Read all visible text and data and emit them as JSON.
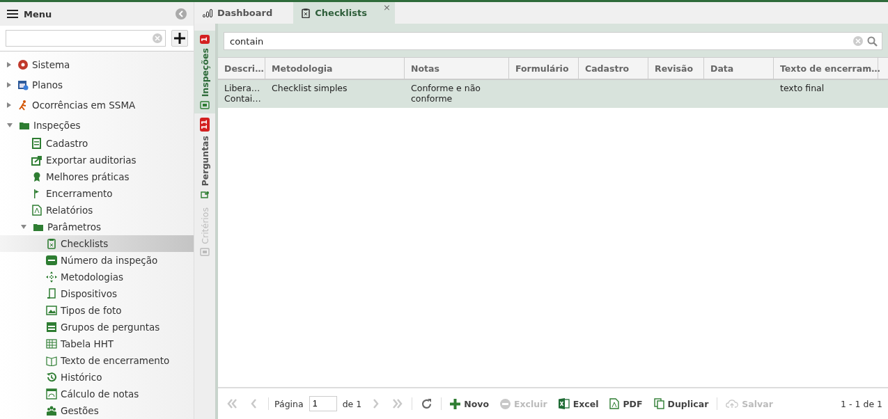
{
  "sidebar": {
    "title": "Menu",
    "tree": [
      {
        "label": "Sistema",
        "expanded": false,
        "selected": false
      },
      {
        "label": "Planos",
        "expanded": false,
        "selected": false
      },
      {
        "label": "Ocorrências em SSMA",
        "expanded": false,
        "selected": false
      },
      {
        "label": "Inspeções",
        "expanded": true,
        "selected": false,
        "children": [
          {
            "label": "Cadastro",
            "selected": false
          },
          {
            "label": "Exportar auditorias",
            "selected": false
          },
          {
            "label": "Melhores práticas",
            "selected": false
          },
          {
            "label": "Encerramento",
            "selected": false
          },
          {
            "label": "Relatórios",
            "selected": false
          },
          {
            "label": "Parâmetros",
            "expanded": true,
            "selected": false,
            "children": [
              {
                "label": "Checklists",
                "selected": true
              },
              {
                "label": "Número da inspeção",
                "selected": false
              },
              {
                "label": "Metodologias",
                "selected": false
              },
              {
                "label": "Dispositivos",
                "selected": false
              },
              {
                "label": "Tipos de foto",
                "selected": false
              },
              {
                "label": "Grupos de perguntas",
                "selected": false
              },
              {
                "label": "Tabela HHT",
                "selected": false
              },
              {
                "label": "Texto de encerramento",
                "selected": false
              },
              {
                "label": "Histórico",
                "selected": false
              },
              {
                "label": "Cálculo de notas",
                "selected": false
              },
              {
                "label": "Gestões",
                "selected": false
              }
            ]
          }
        ]
      }
    ]
  },
  "tabs": [
    {
      "label": "Dashboard",
      "selected": false
    },
    {
      "label": "Checklists",
      "selected": true,
      "close": "×"
    }
  ],
  "side_tabs": [
    {
      "label": "Inspeções",
      "badge": "1",
      "selected": true,
      "disabled": false
    },
    {
      "label": "Perguntas",
      "badge": "11",
      "selected": false,
      "disabled": false
    },
    {
      "label": "Critérios",
      "selected": false,
      "disabled": true
    }
  ],
  "search": {
    "value": "contain"
  },
  "table": {
    "columns": [
      "Descri…",
      "Metodologia",
      "Notas",
      "Formulário",
      "Cadastro",
      "Revisão",
      "Data",
      "Texto de encerram…"
    ],
    "rows": [
      {
        "selected": true,
        "cells": [
          "Libera…\nContai…",
          "Checklist simples",
          "Conforme e não conforme",
          "",
          "",
          "",
          "",
          "texto final"
        ]
      }
    ]
  },
  "pager": {
    "page_label": "Página",
    "page": "1",
    "of": "de 1",
    "buttons": [
      {
        "kind": "first",
        "disabled": true
      },
      {
        "kind": "prev",
        "disabled": true
      },
      {
        "kind": "next",
        "disabled": true
      },
      {
        "kind": "last",
        "disabled": true
      },
      {
        "kind": "refresh",
        "disabled": false
      },
      {
        "kind": "new",
        "label": "Novo",
        "disabled": false
      },
      {
        "kind": "delete",
        "label": "Excluir",
        "disabled": true
      },
      {
        "kind": "excel",
        "label": "Excel",
        "disabled": false
      },
      {
        "kind": "pdf",
        "label": "PDF",
        "disabled": false
      },
      {
        "kind": "copy",
        "label": "Duplicar",
        "disabled": false
      },
      {
        "kind": "save",
        "label": "Salvar",
        "disabled": true
      }
    ],
    "summary": "1 - 1 de 1"
  }
}
